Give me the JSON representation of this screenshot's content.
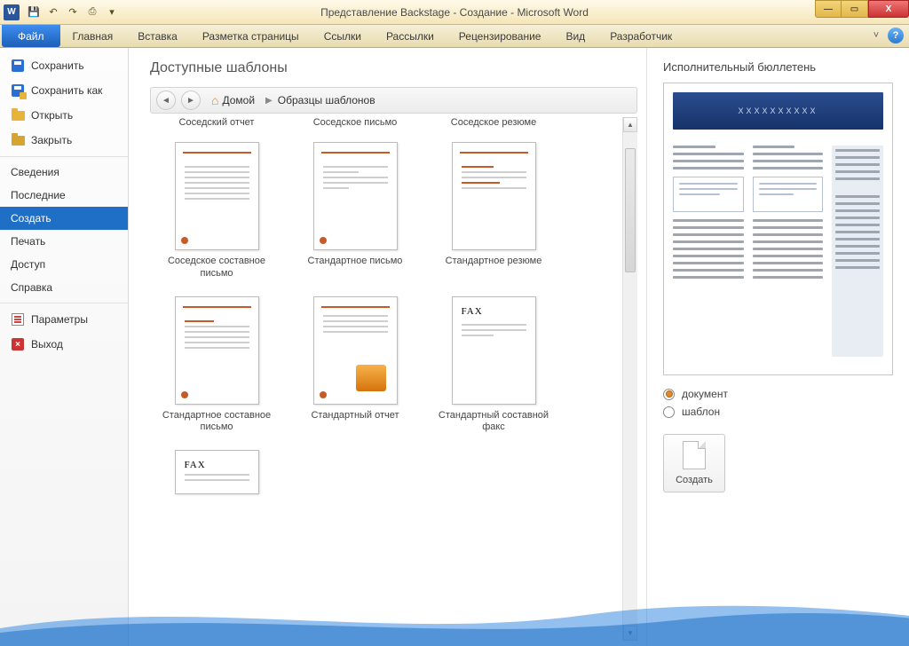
{
  "title": "Представление Backstage - Создание - Microsoft Word",
  "qat": {
    "save": "💾",
    "undo": "↶",
    "redo": "↷",
    "print": "⎙",
    "more": "▾"
  },
  "tabs": {
    "file": "Файл",
    "items": [
      "Главная",
      "Вставка",
      "Разметка страницы",
      "Ссылки",
      "Рассылки",
      "Рецензирование",
      "Вид",
      "Разработчик"
    ]
  },
  "sidebar": {
    "save": "Сохранить",
    "saveAs": "Сохранить как",
    "open": "Открыть",
    "close": "Закрыть",
    "info": "Сведения",
    "recent": "Последние",
    "new": "Создать",
    "print": "Печать",
    "share": "Доступ",
    "help": "Справка",
    "options": "Параметры",
    "exit": "Выход"
  },
  "templates": {
    "heading": "Доступные шаблоны",
    "home": "Домой",
    "location": "Образцы шаблонов",
    "topRow": [
      "Соседский отчет",
      "Соседское письмо",
      "Соседское резюме"
    ],
    "row1": [
      "Соседское составное письмо",
      "Стандартное письмо",
      "Стандартное резюме"
    ],
    "row2": [
      "Стандартное составное письмо",
      "Стандартный отчет",
      "Стандартный составной факс"
    ]
  },
  "preview": {
    "title": "Исполнительный бюллетень",
    "docHeader": "XXXXXXXXXX",
    "radioDoc": "документ",
    "radioTmpl": "шаблон",
    "create": "Создать"
  },
  "win": {
    "min": "—",
    "max": "▭",
    "close": "X",
    "help": "?",
    "up": "˅"
  }
}
